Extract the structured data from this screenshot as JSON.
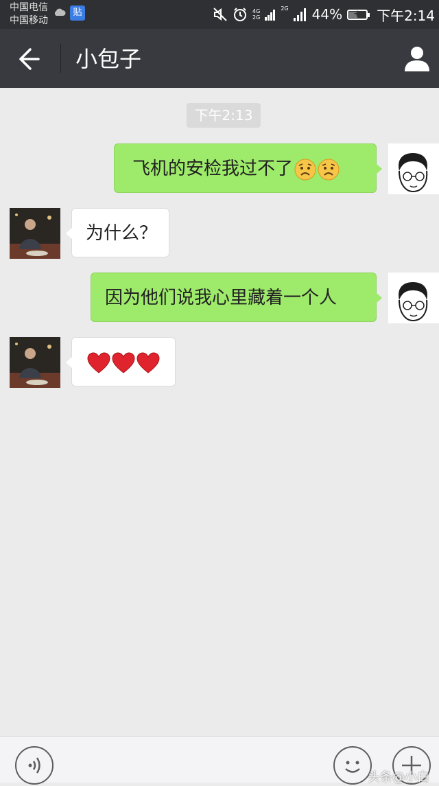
{
  "status_bar": {
    "carrier_1": "中国电信",
    "carrier_2": "中国移动",
    "app_badge": "贴",
    "net_1_top": "4G",
    "net_1_bottom": "2G",
    "net_2": "2G",
    "battery_percent": "44%",
    "battery_level": 0.44,
    "time": "下午2:14"
  },
  "header": {
    "title": "小包子"
  },
  "chat": {
    "timestamp": "下午2:13",
    "messages": [
      {
        "sender": "me",
        "text": "飞机的安检我过不了",
        "emoji": [
          "worried-face",
          "worried-face"
        ]
      },
      {
        "sender": "other",
        "text": "为什么？"
      },
      {
        "sender": "me",
        "text": "因为他们说我心里藏着一个人"
      },
      {
        "sender": "other",
        "text": "",
        "emoji": [
          "red-heart",
          "red-heart",
          "red-heart"
        ]
      }
    ]
  },
  "watermark": "头条@小白"
}
